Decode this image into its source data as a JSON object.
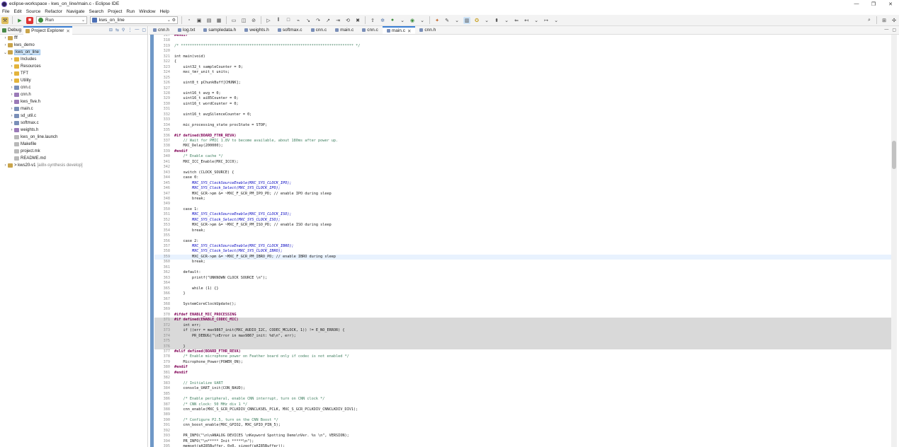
{
  "window": {
    "title": "eclipse-workspace - kws_on_line/main.c - Eclipse IDE",
    "controls": [
      "—",
      "❐",
      "✕"
    ]
  },
  "menubar": [
    "File",
    "Edit",
    "Source",
    "Refactor",
    "Navigate",
    "Search",
    "Project",
    "Run",
    "Window",
    "Help"
  ],
  "toolbar": {
    "run_mode": "Run",
    "launch_config": "kws_on_line"
  },
  "left_panel": {
    "tabs": [
      {
        "label": "Debug",
        "icon": "debug-icon",
        "active": false
      },
      {
        "label": "Project Explorer",
        "icon": "project-explorer-icon",
        "active": true
      }
    ],
    "tree": [
      {
        "label": "fff",
        "indent": 0,
        "arrow": "›",
        "icon": "project"
      },
      {
        "label": "kws_demo",
        "indent": 0,
        "arrow": "›",
        "icon": "project"
      },
      {
        "label": "kws_on_line",
        "indent": 0,
        "arrow": "⌄",
        "icon": "project",
        "selected": true
      },
      {
        "label": "Includes",
        "indent": 1,
        "arrow": "›",
        "icon": "folder"
      },
      {
        "label": "Resources",
        "indent": 1,
        "arrow": "›",
        "icon": "folder"
      },
      {
        "label": "TFT",
        "indent": 1,
        "arrow": "›",
        "icon": "folder"
      },
      {
        "label": "Utility",
        "indent": 1,
        "arrow": "›",
        "icon": "folder"
      },
      {
        "label": "cnn.c",
        "indent": 1,
        "arrow": "›",
        "icon": "file-c"
      },
      {
        "label": "cnn.h",
        "indent": 1,
        "arrow": "›",
        "icon": "file-h"
      },
      {
        "label": "kws_five.h",
        "indent": 1,
        "arrow": "›",
        "icon": "file-h"
      },
      {
        "label": "main.c",
        "indent": 1,
        "arrow": "›",
        "icon": "file-c"
      },
      {
        "label": "sd_util.c",
        "indent": 1,
        "arrow": "›",
        "icon": "file-c"
      },
      {
        "label": "softmax.c",
        "indent": 1,
        "arrow": "›",
        "icon": "file-c"
      },
      {
        "label": "weights.h",
        "indent": 1,
        "arrow": "›",
        "icon": "file-h"
      },
      {
        "label": "kws_on_line.launch",
        "indent": 1,
        "arrow": "",
        "icon": "file-other"
      },
      {
        "label": "Makefile",
        "indent": 1,
        "arrow": "",
        "icon": "file-other"
      },
      {
        "label": "project.mk",
        "indent": 1,
        "arrow": "",
        "icon": "file-other"
      },
      {
        "label": "README.md",
        "indent": 1,
        "arrow": "",
        "icon": "file-other"
      },
      {
        "label": "> kws20-v1",
        "indent": 0,
        "arrow": "›",
        "icon": "project",
        "suffix": "[ai8x-synthesis develop]"
      }
    ]
  },
  "editor": {
    "tabs": [
      {
        "label": "cnn.h",
        "active": false
      },
      {
        "label": "log.txt",
        "active": false
      },
      {
        "label": "sampledata.h",
        "active": false
      },
      {
        "label": "weights.h",
        "active": false
      },
      {
        "label": "softmax.c",
        "active": false
      },
      {
        "label": "cnn.c",
        "active": false
      },
      {
        "label": "main.c",
        "active": false
      },
      {
        "label": "cnn.c",
        "active": false
      },
      {
        "label": "main.c",
        "active": true
      },
      {
        "label": "cnn.h",
        "active": false
      }
    ],
    "lines": [
      {
        "n": "317",
        "t": "#endif",
        "k": "pp"
      },
      {
        "n": "318",
        "t": ""
      },
      {
        "n": "319",
        "t": "/* ****************************************************************************** */",
        "k": "cm"
      },
      {
        "n": "320",
        "t": ""
      },
      {
        "n": "321",
        "t": "int main(void)",
        "k": "kw"
      },
      {
        "n": "322",
        "t": "{"
      },
      {
        "n": "323",
        "t": "    uint32_t sampleCounter = 0;"
      },
      {
        "n": "324",
        "t": "    mxc_tmr_unit_t units;"
      },
      {
        "n": "325",
        "t": ""
      },
      {
        "n": "326",
        "t": "    uint8_t pChunkBuff[CHUNK];"
      },
      {
        "n": "327",
        "t": ""
      },
      {
        "n": "328",
        "t": "    uint16_t avg = 0;"
      },
      {
        "n": "329",
        "t": "    uint16_t ai85Counter = 0;"
      },
      {
        "n": "330",
        "t": "    uint16_t wordCounter = 0;"
      },
      {
        "n": "331",
        "t": ""
      },
      {
        "n": "332",
        "t": "    uint16_t avgSilenceCounter = 0;"
      },
      {
        "n": "333",
        "t": ""
      },
      {
        "n": "334",
        "t": "    mic_processing_state procState = STOP;"
      },
      {
        "n": "335",
        "t": ""
      },
      {
        "n": "336",
        "t": "#if defined(BOARD_FTHR_REVA)",
        "k": "pp"
      },
      {
        "n": "337",
        "t": "    // Wait for PMIC 1.8V to become available, about 180ms after power up.",
        "k": "cm"
      },
      {
        "n": "338",
        "t": "    MXC_Delay(200000);"
      },
      {
        "n": "339",
        "t": "#endif",
        "k": "pp"
      },
      {
        "n": "340",
        "t": "    /* Enable cache */",
        "k": "cm"
      },
      {
        "n": "341",
        "t": "    MXC_ICC_Enable(MXC_ICC0);"
      },
      {
        "n": "342",
        "t": ""
      },
      {
        "n": "343",
        "t": "    switch (CLOCK_SOURCE) {",
        "k": "kw"
      },
      {
        "n": "344",
        "t": "    case 0:",
        "k": "kw"
      },
      {
        "n": "345",
        "t": "        MXC_SYS_ClockSourceEnable(MXC_SYS_CLOCK_IPO);",
        "k": "mac"
      },
      {
        "n": "346",
        "t": "        MXC_SYS_Clock_Select(MXC_SYS_CLOCK_IPO);",
        "k": "mac"
      },
      {
        "n": "347",
        "t": "        MXC_GCR->pm &= ~MXC_F_GCR_PM_IPO_PD; // enable IPO during sleep"
      },
      {
        "n": "348",
        "t": "        break;",
        "k": "kw"
      },
      {
        "n": "349",
        "t": ""
      },
      {
        "n": "350",
        "t": "    case 1:",
        "k": "kw"
      },
      {
        "n": "351",
        "t": "        MXC_SYS_ClockSourceEnable(MXC_SYS_CLOCK_ISO);",
        "k": "mac"
      },
      {
        "n": "352",
        "t": "        MXC_SYS_Clock_Select(MXC_SYS_CLOCK_ISO);",
        "k": "mac"
      },
      {
        "n": "353",
        "t": "        MXC_GCR->pm &= ~MXC_F_GCR_PM_ISO_PD; // enable ISO during sleep"
      },
      {
        "n": "354",
        "t": "        break;",
        "k": "kw"
      },
      {
        "n": "355",
        "t": ""
      },
      {
        "n": "356",
        "t": "    case 2:",
        "k": "kw"
      },
      {
        "n": "357",
        "t": "        MXC_SYS_ClockSourceEnable(MXC_SYS_CLOCK_IBRO);",
        "k": "mac"
      },
      {
        "n": "358",
        "t": "        MXC_SYS_Clock_Select(MXC_SYS_CLOCK_IBRO);",
        "k": "mac"
      },
      {
        "n": "359",
        "t": "        MXC_GCR->pm &= ~MXC_F_GCR_PM_IBRO_PD; // enable IBRO during sleep",
        "hl": "cur"
      },
      {
        "n": "360",
        "t": "        break;",
        "k": "kw"
      },
      {
        "n": "361",
        "t": ""
      },
      {
        "n": "362",
        "t": "    default:",
        "k": "kw"
      },
      {
        "n": "363",
        "t": "        printf(\"UNKNOWN CLOCK SOURCE \\n\");"
      },
      {
        "n": "364",
        "t": ""
      },
      {
        "n": "365",
        "t": "        while (1) {}",
        "k": "kw"
      },
      {
        "n": "366",
        "t": "    }"
      },
      {
        "n": "367",
        "t": ""
      },
      {
        "n": "368",
        "t": "    SystemCoreClockUpdate();"
      },
      {
        "n": "369",
        "t": ""
      },
      {
        "n": "370",
        "t": "#ifdef ENABLE_MIC_PROCESSING",
        "k": "pp"
      },
      {
        "n": "371",
        "t": "#if defined(ENABLE_CODEC_MIC)",
        "k": "pp",
        "hl": "ifdef"
      },
      {
        "n": "372",
        "t": "    int err;",
        "hl": "ifdef"
      },
      {
        "n": "373",
        "t": "    if ((err = max9867_init(MXC_AUDIO_I2C, CODEC_MCLOCK, 1)) != E_NO_ERROR) {",
        "hl": "ifdef"
      },
      {
        "n": "374",
        "t": "        PR_DEBUG(\"\\nError in max9867_init: %d\\n\", err);",
        "hl": "ifdef"
      },
      {
        "n": "375",
        "t": "",
        "hl": "ifdef"
      },
      {
        "n": "376",
        "t": "    }",
        "hl": "ifdef"
      },
      {
        "n": "377",
        "t": "#elif defined(BOARD_FTHR_REVA)",
        "k": "pp"
      },
      {
        "n": "378",
        "t": "    /* Enable microphone power on Feather board only if codec is not enabled */",
        "k": "cm"
      },
      {
        "n": "379",
        "t": "    Microphone_Power(POWER_ON);"
      },
      {
        "n": "380",
        "t": "#endif",
        "k": "pp"
      },
      {
        "n": "381",
        "t": "#endif",
        "k": "pp"
      },
      {
        "n": "382",
        "t": ""
      },
      {
        "n": "383",
        "t": "    // Initialize UART",
        "k": "cm"
      },
      {
        "n": "384",
        "t": "    console_UART_init(CON_BAUD);"
      },
      {
        "n": "385",
        "t": ""
      },
      {
        "n": "386",
        "t": "    /* Enable peripheral, enable CNN interrupt, turn on CNN clock */",
        "k": "cm"
      },
      {
        "n": "387",
        "t": "    /* CNN clock: 50 MHz div 1 */",
        "k": "cm"
      },
      {
        "n": "388",
        "t": "    cnn_enable(MXC_S_GCR_PCLKDIV_CNNCLKSEL_PCLK, MXC_S_GCR_PCLKDIV_CNNCLKDIV_DIV1);"
      },
      {
        "n": "389",
        "t": ""
      },
      {
        "n": "390",
        "t": "    /* Configure P2.5, turn on the CNN Boost */",
        "k": "cm"
      },
      {
        "n": "391",
        "t": "    cnn_boost_enable(MXC_GPIO2, MXC_GPIO_PIN_5);"
      },
      {
        "n": "392",
        "t": ""
      },
      {
        "n": "393",
        "t": "    PR_INFO(\"\\n\\nANALOG DEVICES \\nKeyword Spotting Demo\\nVer. %s \\n\", VERSION);"
      },
      {
        "n": "394",
        "t": "    PR_INFO(\"\\n***** Init *****\\n\");"
      },
      {
        "n": "395",
        "t": "    memset(pAI85Buffer, 0x0, sizeof(pAI85Buffer));"
      }
    ]
  }
}
